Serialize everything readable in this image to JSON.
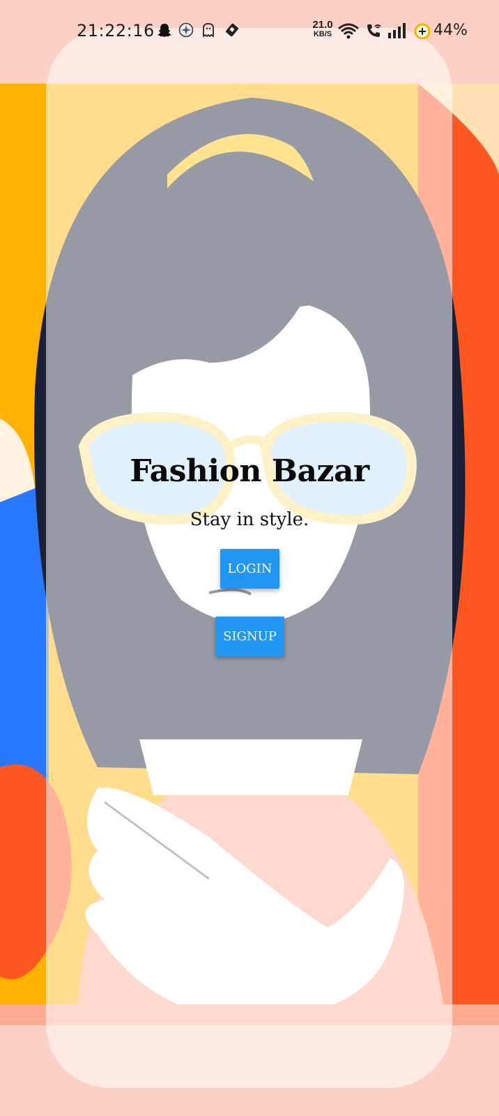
{
  "status_bar": {
    "time": "21:22:16",
    "notification_icons": [
      "snapchat-icon",
      "compass-icon",
      "ghost-icon",
      "sim-card-icon"
    ],
    "net_speed_value": "21.0",
    "net_speed_unit": "KB/S",
    "system_icons": [
      "wifi-icon",
      "wifi-call-icon",
      "signal-icon",
      "battery-saver-icon"
    ],
    "battery_percent": "44%"
  },
  "app": {
    "title": "Fashion Bazar",
    "subtitle": "Stay in style.",
    "login_label": "LOGIN",
    "signup_label": "SIGNUP"
  },
  "colors": {
    "background": "#fcd1c5",
    "button": "#2196f3",
    "illustration_yellow": "#ffb300",
    "illustration_orange": "#ff5722",
    "illustration_blue": "#2979ff",
    "hair": "#1a2035"
  }
}
